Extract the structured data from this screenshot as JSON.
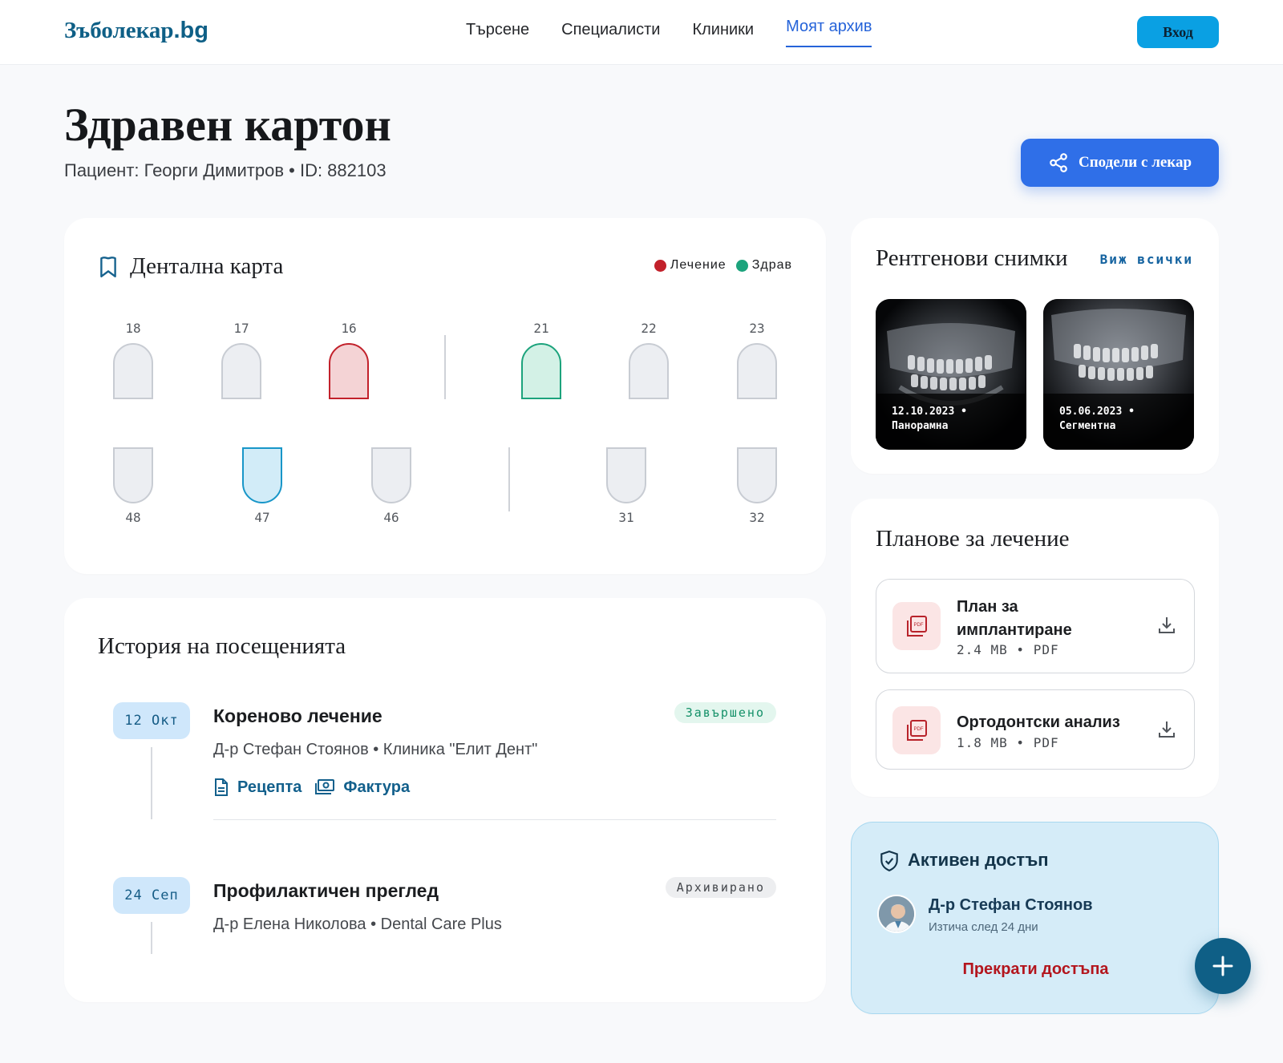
{
  "header": {
    "logo_name": "Зъболекар",
    "logo_tld": ".bg",
    "nav": [
      "Търсене",
      "Специалисти",
      "Клиники",
      "Моят архив"
    ],
    "login_label": "Вход"
  },
  "page": {
    "title": "Здравен картон",
    "patient": "Пациент: Георги Димитров • ID: 882103",
    "share_label": "Сподели с лекар"
  },
  "dental_chart": {
    "title": "Дентална карта",
    "legend": {
      "treatment": "Лечение",
      "healthy": "Здрав"
    },
    "colors": {
      "treatment": "#c2212b",
      "healthy": "#1ca37c",
      "monitor": "#1896c8"
    },
    "upper": [
      {
        "num": "18",
        "status": "normal"
      },
      {
        "num": "17",
        "status": "normal"
      },
      {
        "num": "16",
        "status": "treatment"
      },
      {
        "num": "21",
        "status": "healthy"
      },
      {
        "num": "22",
        "status": "normal"
      },
      {
        "num": "23",
        "status": "normal"
      }
    ],
    "lower": [
      {
        "num": "48",
        "status": "normal"
      },
      {
        "num": "47",
        "status": "monitor"
      },
      {
        "num": "46",
        "status": "normal"
      },
      {
        "num": "31",
        "status": "normal"
      },
      {
        "num": "32",
        "status": "normal"
      }
    ]
  },
  "history": {
    "title": "История на посещенията",
    "visits": [
      {
        "date": "12 Окт",
        "title": "Кореново лечение",
        "sub": "Д-р Стефан Стоянов • Клиника \"Елит Дент\"",
        "badge": "Завършено",
        "links": [
          "Рецепта",
          "Фактура"
        ]
      },
      {
        "date": "24 Сеп",
        "title": "Профилактичен преглед",
        "sub": "Д-р Елена Николова • Dental Care Plus",
        "badge": "Архивирано"
      }
    ]
  },
  "xrays": {
    "title": "Рентгенови снимки",
    "view_all": "Виж всички",
    "items": [
      {
        "date": "12.10.2023 •",
        "type": "Панорамна"
      },
      {
        "date": "05.06.2023 •",
        "type": "Сегментна"
      }
    ]
  },
  "plans": {
    "title": "Планове за лечение",
    "items": [
      {
        "name_1": "План за",
        "name_2": "имплантиране",
        "meta": "2.4 MB • PDF"
      },
      {
        "name": "Ортодонтски анализ",
        "meta": "1.8 MB • PDF"
      }
    ]
  },
  "access": {
    "title": "Активен достъп",
    "doctor": "Д-р Стефан Стоянов",
    "expires": "Изтича след 24 дни",
    "revoke": "Прекрати достъпа"
  }
}
